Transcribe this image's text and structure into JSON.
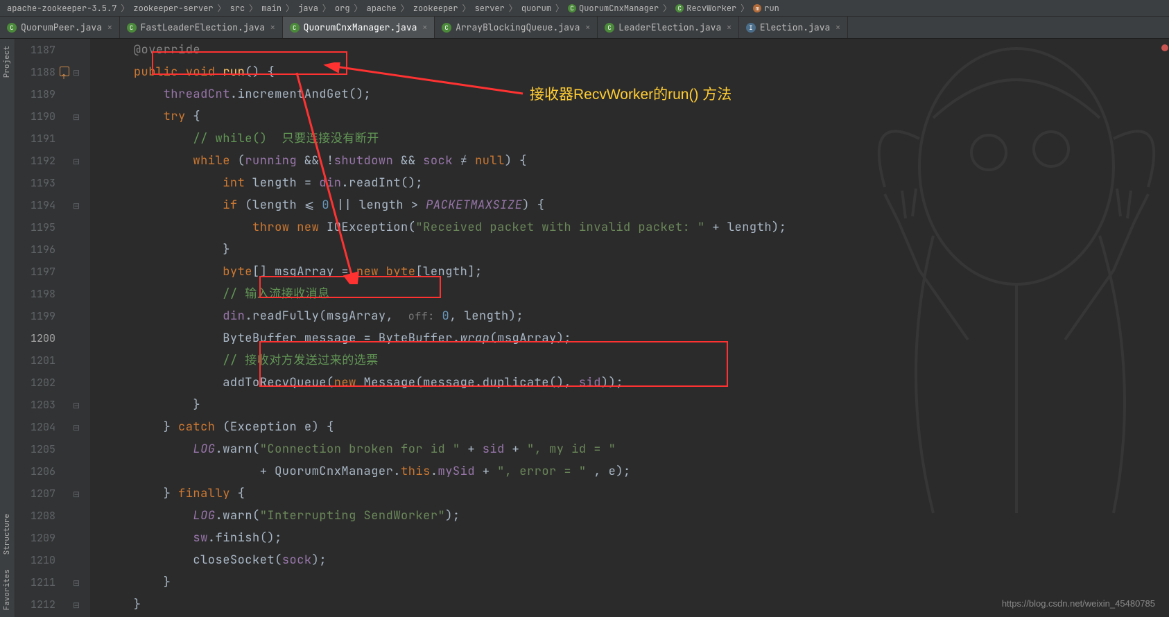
{
  "breadcrumb": [
    {
      "label": "apache-zookeeper-3.5.7",
      "icon": ""
    },
    {
      "label": "zookeeper-server",
      "icon": ""
    },
    {
      "label": "src",
      "icon": ""
    },
    {
      "label": "main",
      "icon": ""
    },
    {
      "label": "java",
      "icon": ""
    },
    {
      "label": "org",
      "icon": ""
    },
    {
      "label": "apache",
      "icon": ""
    },
    {
      "label": "zookeeper",
      "icon": ""
    },
    {
      "label": "server",
      "icon": ""
    },
    {
      "label": "quorum",
      "icon": ""
    },
    {
      "label": "QuorumCnxManager",
      "icon": "class"
    },
    {
      "label": "RecvWorker",
      "icon": "class"
    },
    {
      "label": "run",
      "icon": "method"
    }
  ],
  "tabs": [
    {
      "label": "QuorumPeer.java",
      "active": false,
      "icon": "green"
    },
    {
      "label": "FastLeaderElection.java",
      "active": false,
      "icon": "green"
    },
    {
      "label": "QuorumCnxManager.java",
      "active": true,
      "icon": "green"
    },
    {
      "label": "ArrayBlockingQueue.java",
      "active": false,
      "icon": "green"
    },
    {
      "label": "LeaderElection.java",
      "active": false,
      "icon": "green"
    },
    {
      "label": "Election.java",
      "active": false,
      "icon": "blue"
    }
  ],
  "sidebar": {
    "project": "Project",
    "structure": "Structure",
    "favorites": "Favorites"
  },
  "annotations": {
    "run_label": "接收器RecvWorker的run() 方法"
  },
  "watermark": "https://blog.csdn.net/weixin_45480785",
  "gutter_start": 1187,
  "current_line": 1200,
  "code_lines": [
    {
      "n": 1187,
      "fold": "",
      "html": "<span class='com'>    @override</span>"
    },
    {
      "n": 1188,
      "fold": "minus",
      "html": "    <span class='kw'>public</span> <span class='kw'>void</span> <span class='fn'>run</span>() {",
      "override": true
    },
    {
      "n": 1189,
      "fold": "",
      "html": "        <span class='field'>threadCnt</span>.incrementAndGet();"
    },
    {
      "n": 1190,
      "fold": "minus",
      "html": "        <span class='kw'>try</span> {"
    },
    {
      "n": 1191,
      "fold": "",
      "html": "            <span class='com-green'>// while()  只要连接没有断开</span>"
    },
    {
      "n": 1192,
      "fold": "minus",
      "html": "            <span class='kw'>while</span> (<span class='field'>running</span> && !<span class='field'>shutdown</span> && <span class='field'>sock</span> ≠ <span class='kw'>null</span>) {"
    },
    {
      "n": 1193,
      "fold": "",
      "html": "                <span class='kw'>int</span> length = <span class='field'>din</span>.readInt();"
    },
    {
      "n": 1194,
      "fold": "minus",
      "html": "                <span class='kw'>if</span> (length ⩽ <span class='num'>0</span> || length > <span class='field it'>PACKETMAXSIZE</span>) {"
    },
    {
      "n": 1195,
      "fold": "",
      "html": "                    <span class='kw'>throw</span> <span class='kw'>new</span> IOException(<span class='str'>\"Received packet with invalid packet: \"</span> + length);"
    },
    {
      "n": 1196,
      "fold": "",
      "html": "                }"
    },
    {
      "n": 1197,
      "fold": "",
      "html": "                <span class='kw'>byte</span>[] msgArray = <span class='kw'>new</span> <span class='kw'>byte</span>[length];"
    },
    {
      "n": 1198,
      "fold": "",
      "html": "                <span class='com-green'>// 输入流接收消息</span>"
    },
    {
      "n": 1199,
      "fold": "",
      "html": "                <span class='field'>din</span>.readFully(msgArray,  <span class='param-hint'>off:</span> <span class='num'>0</span>, length);"
    },
    {
      "n": 1200,
      "fold": "",
      "html": "                ByteBuffer message = ByteBuffer.<span class='it'>wrap</span>(msgArray);"
    },
    {
      "n": 1201,
      "fold": "",
      "html": "                <span class='com-green'>// 接收对方发送过来的选票</span>"
    },
    {
      "n": 1202,
      "fold": "",
      "html": "                addToRecvQueue(<span class='kw'>new</span> Message(message.duplicate(), <span class='field'>sid</span>));"
    },
    {
      "n": 1203,
      "fold": "minus",
      "html": "            }"
    },
    {
      "n": 1204,
      "fold": "minus",
      "html": "        } <span class='kw'>catch</span> (Exception e) {"
    },
    {
      "n": 1205,
      "fold": "",
      "html": "            <span class='field it'>LOG</span>.warn(<span class='str'>\"Connection broken for id \"</span> + <span class='field'>sid</span> + <span class='str'>\", my id = \"</span>"
    },
    {
      "n": 1206,
      "fold": "",
      "html": "                     + QuorumCnxManager.<span class='kw'>this</span>.<span class='field'>mySid</span> + <span class='str'>\", error = \"</span> , e);"
    },
    {
      "n": 1207,
      "fold": "minus",
      "html": "        } <span class='kw'>finally</span> {"
    },
    {
      "n": 1208,
      "fold": "",
      "html": "            <span class='field it'>LOG</span>.warn(<span class='str'>\"Interrupting SendWorker\"</span>);"
    },
    {
      "n": 1209,
      "fold": "",
      "html": "            <span class='field'>sw</span>.finish();"
    },
    {
      "n": 1210,
      "fold": "",
      "html": "            closeSocket(<span class='field'>sock</span>);"
    },
    {
      "n": 1211,
      "fold": "minus",
      "html": "        }"
    },
    {
      "n": 1212,
      "fold": "minus",
      "html": "    }"
    }
  ]
}
